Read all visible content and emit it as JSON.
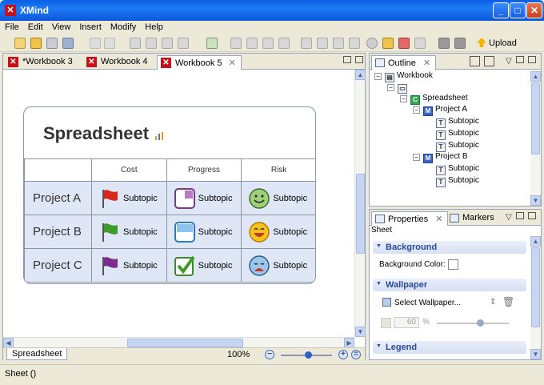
{
  "window": {
    "title": "XMind"
  },
  "menu": [
    "File",
    "Edit",
    "View",
    "Insert",
    "Modify",
    "Help"
  ],
  "toolbar": {
    "upload_label": "Upload"
  },
  "editor": {
    "tabs": [
      {
        "label": "*Workbook 3",
        "active": false
      },
      {
        "label": "Workbook 4",
        "active": false
      },
      {
        "label": "Workbook 5",
        "active": true
      }
    ],
    "sheet_tab": "Spreadsheet",
    "zoom": "100%"
  },
  "spreadsheet": {
    "title": "Spreadsheet",
    "columns": [
      "Cost",
      "Progress",
      "Risk"
    ],
    "rows": [
      {
        "label": "Project A",
        "cells": [
          "Subtopic",
          "Subtopic",
          "Subtopic"
        ]
      },
      {
        "label": "Project B",
        "cells": [
          "Subtopic",
          "Subtopic",
          "Subtopic"
        ]
      },
      {
        "label": "Project C",
        "cells": [
          "Subtopic",
          "Subtopic",
          "Subtopic"
        ]
      }
    ]
  },
  "outline": {
    "tab": "Outline",
    "nodes": [
      {
        "label": "Workbook",
        "icon": "workbook-icon"
      },
      {
        "label": "",
        "icon": "sheet-icon"
      },
      {
        "label": "Spreadsheet",
        "icon": "C"
      },
      {
        "label": "Project A",
        "icon": "M"
      },
      {
        "label": "Subtopic",
        "icon": "T"
      },
      {
        "label": "Subtopic",
        "icon": "T"
      },
      {
        "label": "Subtopic",
        "icon": "T"
      },
      {
        "label": "Project B",
        "icon": "M"
      },
      {
        "label": "Subtopic",
        "icon": "T"
      },
      {
        "label": "Subtopic",
        "icon": "T"
      }
    ]
  },
  "properties": {
    "tab": "Properties",
    "markers_tab": "Markers",
    "context": "Sheet",
    "background_section": "Background",
    "background_color_label": "Background Color:",
    "wallpaper_section": "Wallpaper",
    "select_wallpaper": "Select Wallpaper...",
    "opacity_value": "60",
    "opacity_unit": "%",
    "legend_section": "Legend"
  },
  "status": {
    "text": "Sheet ()"
  }
}
